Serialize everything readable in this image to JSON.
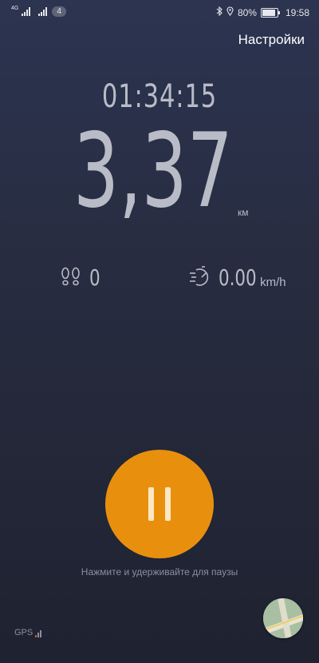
{
  "status_bar": {
    "network_label": "4G",
    "notification_count": "4",
    "battery": "80%",
    "time": "19:58"
  },
  "header": {
    "settings_label": "Настройки"
  },
  "workout": {
    "duration": "01:34:15",
    "distance": "3,37",
    "distance_unit": "км",
    "steps": "0",
    "speed": "0.00",
    "speed_unit": "km/h"
  },
  "controls": {
    "hint": "Нажмите и удерживайте для паузы",
    "gps_label": "GPS"
  },
  "colors": {
    "accent": "#e8900e",
    "background_top": "#2c3450",
    "background_bottom": "#1f2230"
  }
}
